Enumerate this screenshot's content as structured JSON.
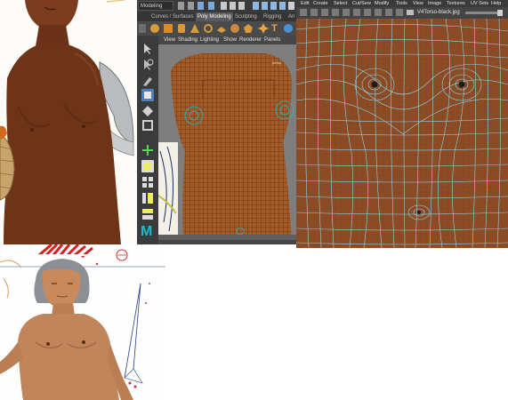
{
  "maya": {
    "mode_select": "Modeling",
    "shelf_tabs": [
      "Curves / Surfaces",
      "Poly Modeling",
      "Sculpting",
      "Rigging",
      "An"
    ],
    "active_shelf_tab": "Poly Modeling",
    "panel_menu": [
      "View",
      "Shading",
      "Lighting",
      "Show",
      "Renderer",
      "Panels"
    ],
    "logo_letter": "M",
    "accent_color": "#1fb9c8"
  },
  "uv_editor": {
    "menu": [
      "Edit",
      "Create",
      "Select",
      "Cut/Sew",
      "Modify",
      "Tools",
      "View",
      "Image",
      "Textures",
      "UV Sets",
      "Help"
    ],
    "image_name": "V4Torso-black.jpg",
    "texture_color": "#8a4b25",
    "wire_color": "#8fe3ff"
  },
  "renders": {
    "top": {
      "skin_color": "#6e3418"
    },
    "bottom": {
      "skin_color": "#c0855a"
    }
  }
}
